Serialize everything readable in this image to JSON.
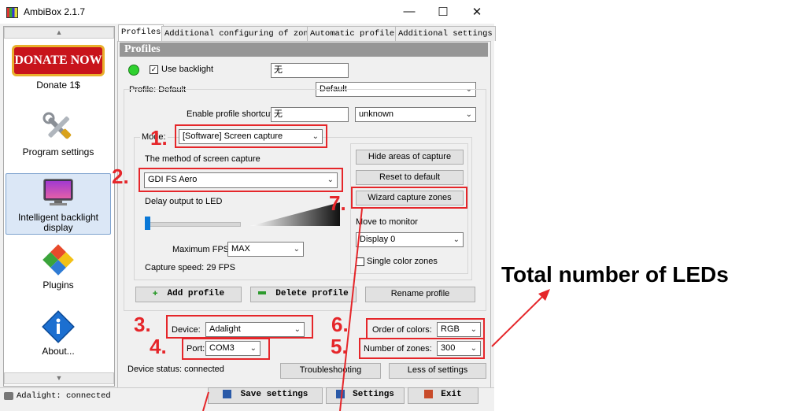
{
  "window": {
    "title": "AmbiBox 2.1.7",
    "minimize": "—",
    "maximize": "☐",
    "close": "✕"
  },
  "sidebar": {
    "donate_banner": "DONATE NOW",
    "items": [
      {
        "label": "Donate 1$"
      },
      {
        "label": "Program settings"
      },
      {
        "label": "Intelligent backlight display"
      },
      {
        "label": "Plugins"
      },
      {
        "label": "About..."
      }
    ]
  },
  "tabs": [
    {
      "label": "Profiles"
    },
    {
      "label": "Additional configuring of zones"
    },
    {
      "label": "Automatic profiles"
    },
    {
      "label": "Additional settings"
    }
  ],
  "profiles": {
    "header": "Profiles",
    "use_backlight_label": "Use backlight",
    "use_backlight_checked": true,
    "top_input_value": "无",
    "profile_label": "Profile: Default",
    "profile_select": "Default",
    "shortcut_label": "Enable profile shortcut:",
    "shortcut_value": "无",
    "shortcut_select": "unknown",
    "mode_label": "Mode:",
    "mode_value": "[Software] Screen capture",
    "method_label": "The method of screen capture",
    "method_value": "GDI FS Aero",
    "delay_label": "Delay output to LED",
    "max_fps_label": "Maximum FPS",
    "max_fps_value": "MAX",
    "capture_speed": "Capture speed: 29 FPS",
    "hide_areas_button": "Hide areas of capture",
    "reset_default_button": "Reset to default",
    "wizard_button": "Wizard capture zones",
    "move_monitor_label": "Move to monitor",
    "monitor_value": "Display 0",
    "single_color_label": "Single color zones",
    "add_profile_button": "Add profile",
    "delete_profile_button": "Delete profile",
    "rename_profile_button": "Rename profile"
  },
  "device": {
    "device_label": "Device:",
    "device_value": "Adalight",
    "port_label": "Port:",
    "port_value": "COM3",
    "order_label": "Order of colors:",
    "order_value": "RGB",
    "zones_label": "Number of zones:",
    "zones_value": "300",
    "status": "Device status: connected",
    "troubleshooting_button": "Troubleshooting",
    "less_settings_button": "Less of settings"
  },
  "bottom": {
    "status_text": "Adalight: connected",
    "save_button": "Save settings",
    "settings_button": "Settings",
    "exit_button": "Exit"
  },
  "annotations": {
    "n1": "1.",
    "n2": "2.",
    "n3": "3.",
    "n4": "4.",
    "n5": "5.",
    "n6": "6.",
    "n7": "7.",
    "total_leds": "Total number of LEDs",
    "accent_color": "#e5262a"
  }
}
